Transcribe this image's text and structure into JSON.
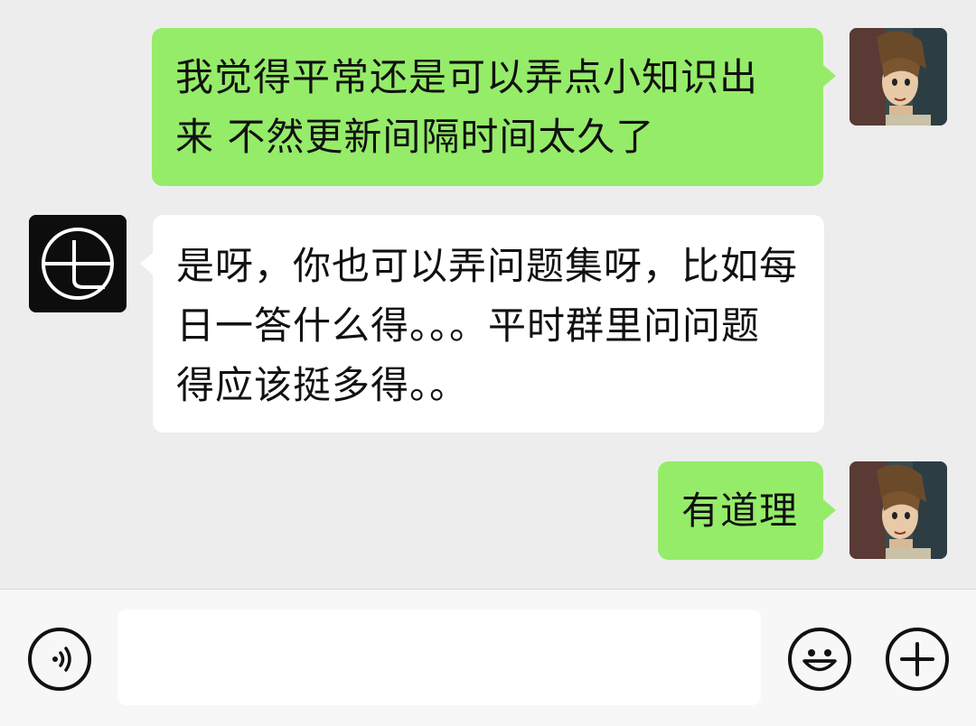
{
  "messages": [
    {
      "direction": "sent",
      "lines": [
        "我觉得平常还是可以弄点小知识出",
        "来 不然更新间隔时间太久了"
      ]
    },
    {
      "direction": "received",
      "lines": [
        "是呀，你也可以弄问题集呀，比如每",
        "日一答什么得。。。平时群里问问题",
        "得应该挺多得。。"
      ]
    },
    {
      "direction": "sent",
      "lines": [
        "有道理"
      ]
    }
  ],
  "input": {
    "value": "",
    "placeholder": ""
  },
  "icons": {
    "voice": "voice-icon",
    "emoji": "emoji-icon",
    "add": "plus-icon"
  },
  "colors": {
    "background": "#ededed",
    "sent_bubble": "#95ec69",
    "received_bubble": "#ffffff",
    "input_bar": "#f7f7f7"
  }
}
